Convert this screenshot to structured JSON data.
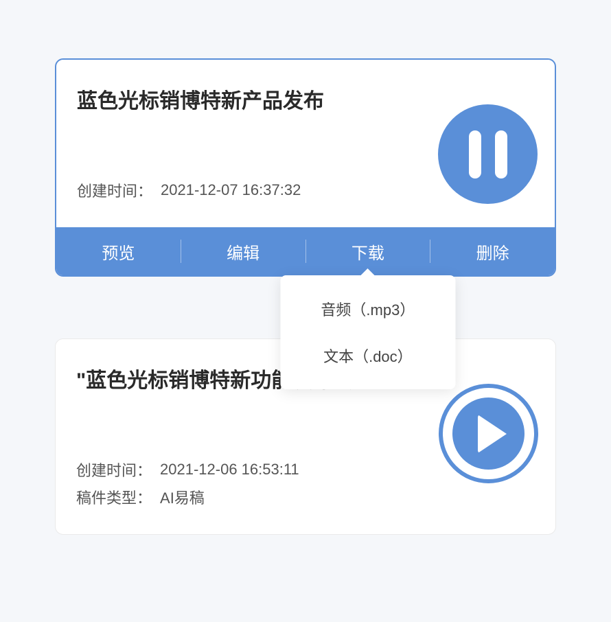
{
  "cards": [
    {
      "title": "蓝色光标销博特新产品发布",
      "created_label": "创建时间：",
      "created_value": "2021-12-07 16:37:32",
      "playing": true
    },
    {
      "title": "\"蓝色光标销博特新功能发布会",
      "created_label": "创建时间：",
      "created_value": "2021-12-06 16:53:11",
      "type_label": "稿件类型：",
      "type_value": "AI易稿",
      "playing": false
    }
  ],
  "actions": {
    "preview": "预览",
    "edit": "编辑",
    "download": "下载",
    "delete": "删除"
  },
  "download_menu": {
    "audio": "音频（.mp3）",
    "text": "文本（.doc）"
  }
}
